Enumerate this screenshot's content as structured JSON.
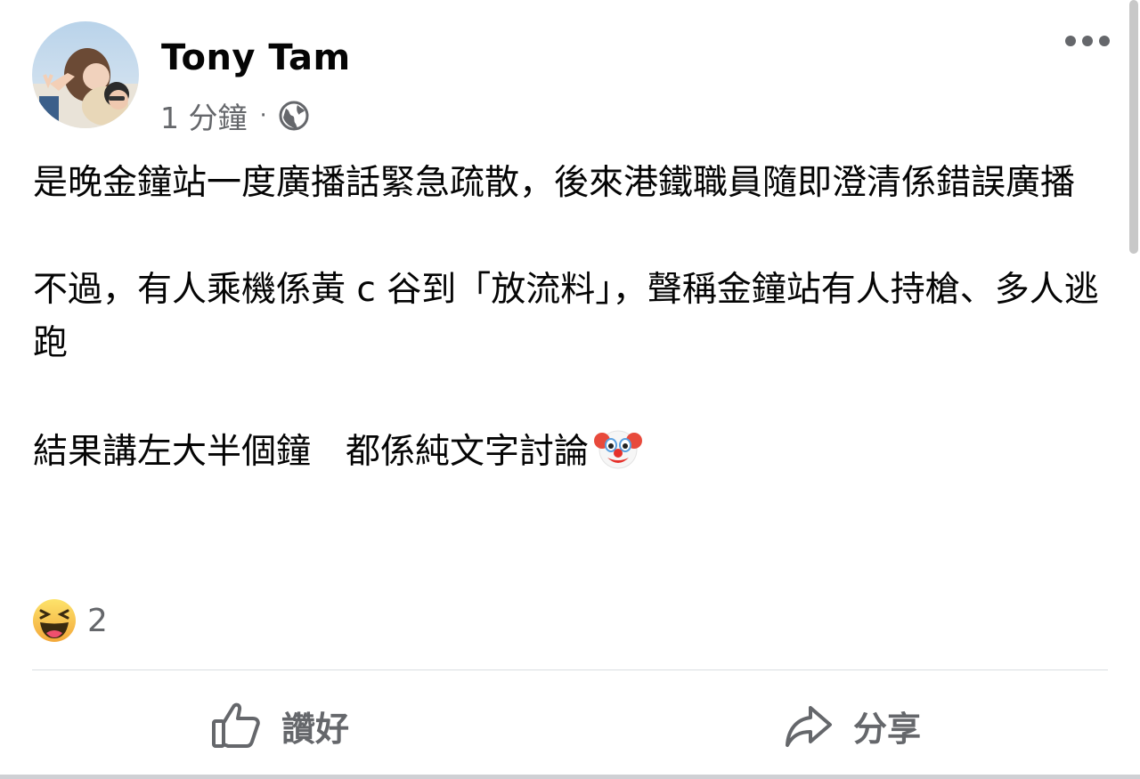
{
  "post": {
    "author": "Tony Tam",
    "timestamp": "1 分鐘",
    "separator": "·",
    "privacy_icon": "globe-icon",
    "more_icon": "more-horizontal-icon",
    "paragraphs": [
      "是晚金鐘站一度廣播話緊急疏散，後來港鐵職員隨即澄清係錯誤廣播",
      "不過，有人乘機係黃 c 谷到「放流料」，聲稱金鐘站有人持槍、多人逃跑",
      "結果講左大半個鐘　都係純文字討論"
    ],
    "trailing_emoji": "clown-face-emoji",
    "reactions": {
      "icon": "laughing-haha-emoji",
      "count": "2"
    }
  },
  "actions": {
    "like_label": "讚好",
    "like_icon": "thumbs-up-icon",
    "share_label": "分享",
    "share_icon": "share-arrow-icon"
  },
  "colors": {
    "text": "#050505",
    "secondary": "#65676b",
    "divider": "#dadde1"
  }
}
